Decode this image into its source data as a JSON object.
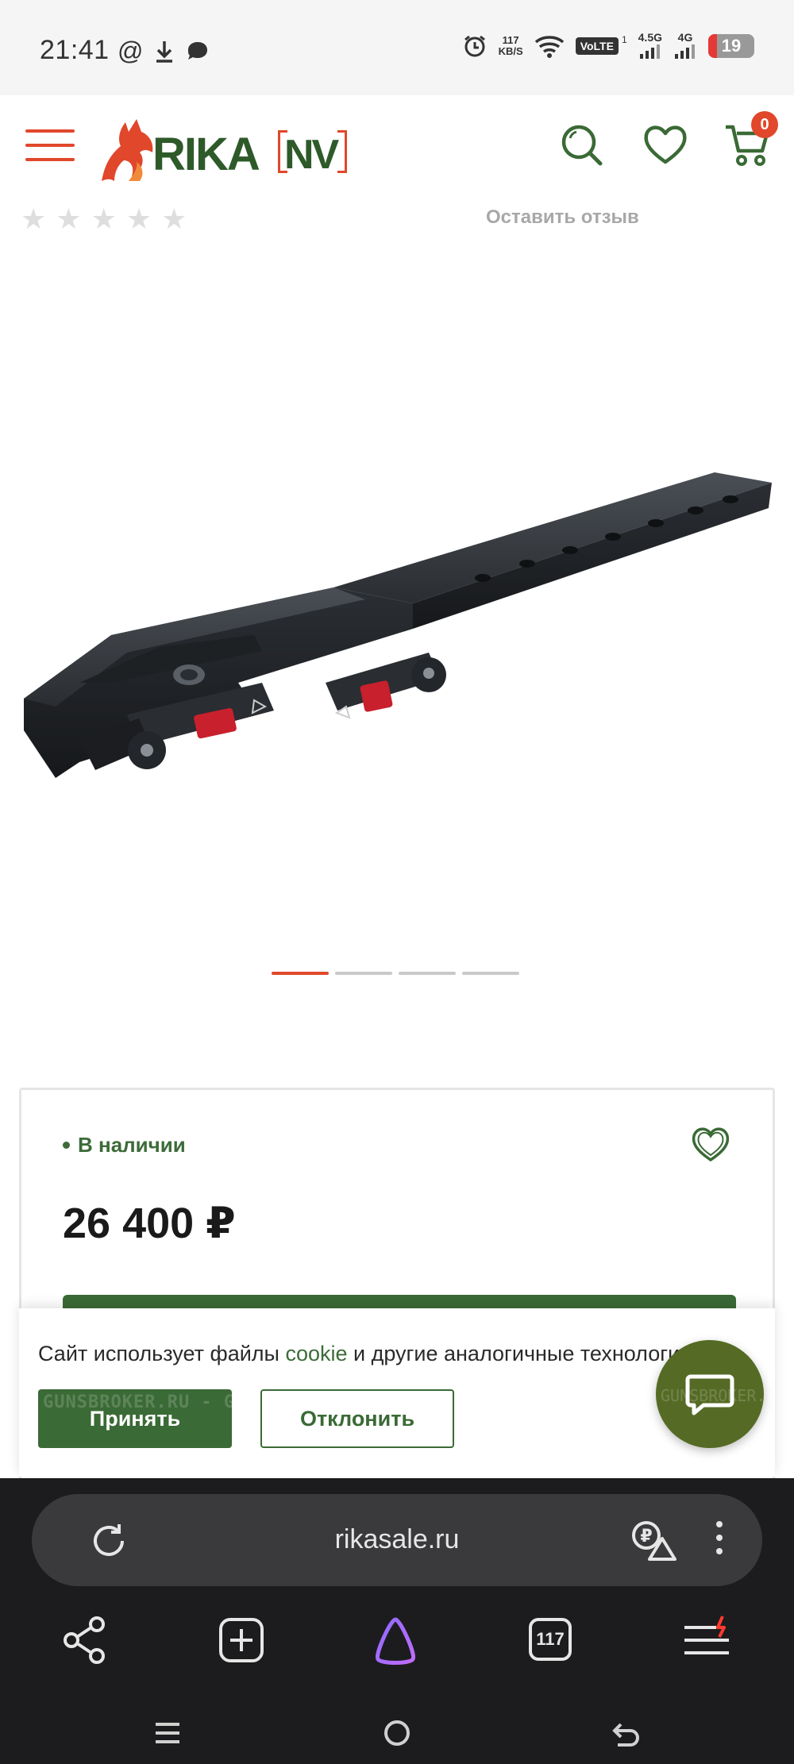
{
  "status_bar": {
    "time": "21:41",
    "speed_value": "117",
    "speed_unit": "KB/S",
    "volte": "VoLTE",
    "volte_sim": "1",
    "net1": "4.5G",
    "net2": "4G",
    "battery": "19",
    "battery_level": 0.19
  },
  "header": {
    "cart_count": "0",
    "logo_text": "RIKA NV"
  },
  "product": {
    "review_link": "Оставить отзыв",
    "stars_filled": 0,
    "stars_total": 5,
    "gallery_active": 0,
    "gallery_count": 4,
    "stock": "В наличии",
    "price": "26 400 ₽"
  },
  "cookie": {
    "text_before": "Сайт использует файлы ",
    "link": "cookie",
    "text_after": " и другие аналогичные технологии",
    "accept": "Принять",
    "decline": "Отклонить",
    "watermark": "GUNSBROKER.RU - GUNSBROKER.RU"
  },
  "browser": {
    "url": "rikasale.ru",
    "tabs_count": "117"
  },
  "colors": {
    "accent_orange": "#e1472b",
    "brand_green": "#3a6a35",
    "chat_green": "#556b25"
  }
}
